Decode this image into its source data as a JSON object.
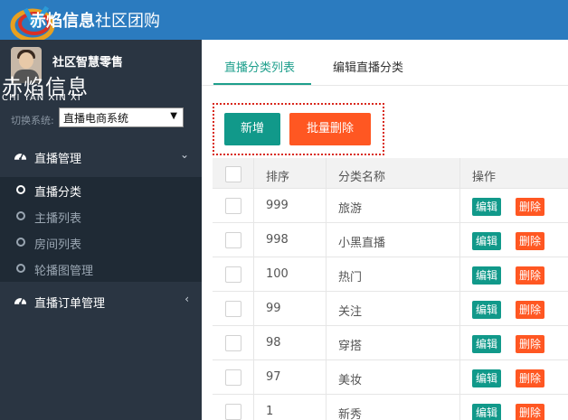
{
  "brand": {
    "title_bold": "赤焰信息",
    "title_light": "社区团购"
  },
  "watermark": {
    "cn": "赤焰信息",
    "en": "CHI YAN XIN XI"
  },
  "user": {
    "name": "社区智慧零售"
  },
  "switch": {
    "label": "切换系统:",
    "selected": "直播电商系统"
  },
  "menu": {
    "groups": [
      {
        "label": "直播管理",
        "arrow": "⌄"
      },
      {
        "label": "直播订单管理",
        "arrow": "‹"
      }
    ],
    "sub_items": [
      {
        "label": "直播分类"
      },
      {
        "label": "主播列表"
      },
      {
        "label": "房间列表"
      },
      {
        "label": "轮播图管理"
      }
    ]
  },
  "tabs": [
    {
      "label": "直播分类列表"
    },
    {
      "label": "编辑直播分类"
    }
  ],
  "buttons": {
    "add": "新增",
    "batch_delete": "批量删除"
  },
  "table": {
    "headers": {
      "sort": "排序",
      "name": "分类名称",
      "op": "操作"
    },
    "rows": [
      {
        "sort": "999",
        "name": "旅游",
        "edit": "编辑",
        "delete": "删除"
      },
      {
        "sort": "998",
        "name": "小黑直播",
        "edit": "编辑",
        "delete": "删除"
      },
      {
        "sort": "100",
        "name": "热门",
        "edit": "编辑",
        "delete": "删除"
      },
      {
        "sort": "99",
        "name": "关注",
        "edit": "编辑",
        "delete": "删除"
      },
      {
        "sort": "98",
        "name": "穿搭",
        "edit": "编辑",
        "delete": "删除"
      },
      {
        "sort": "97",
        "name": "美妆",
        "edit": "编辑",
        "delete": "删除"
      },
      {
        "sort": "1",
        "name": "新秀",
        "edit": "编辑",
        "delete": "删除"
      }
    ]
  },
  "colors": {
    "header_blue": "#2b7bbf",
    "sidebar": "#2a3542",
    "teal": "#11998a",
    "orange": "#ff5722",
    "highlight_border": "#d9281c"
  }
}
